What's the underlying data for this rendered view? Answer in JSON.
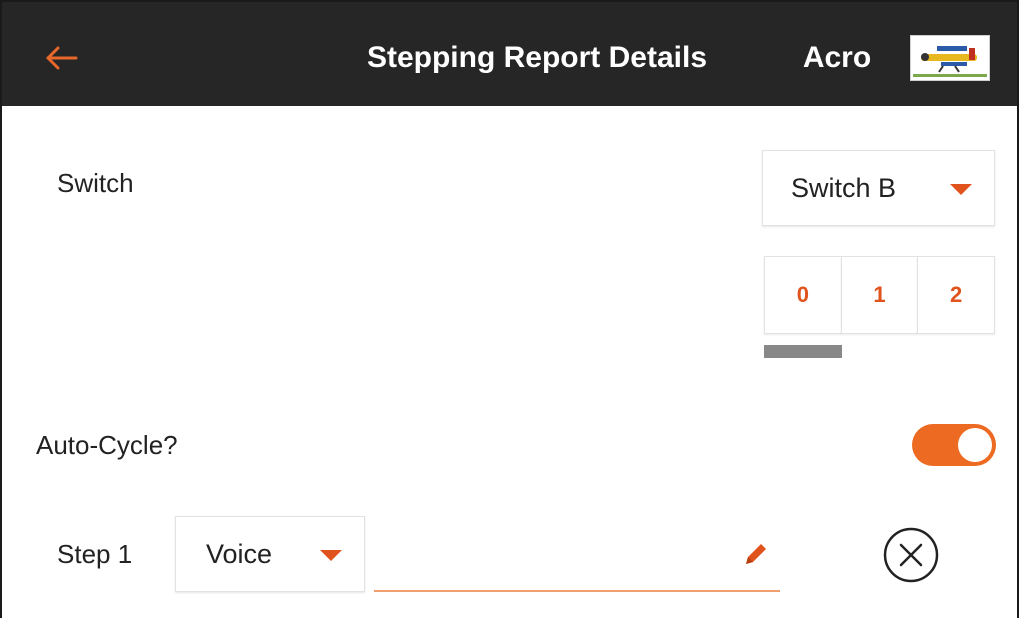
{
  "header": {
    "title": "Stepping Report Details",
    "model_name": "Acro",
    "back_icon": "arrow-left-icon",
    "model_thumbnail": "airplane-thumbnail-icon"
  },
  "switch": {
    "label": "Switch",
    "selected": "Switch B",
    "positions": [
      "0",
      "1",
      "2"
    ],
    "active_position": "0"
  },
  "auto_cycle": {
    "label": "Auto-Cycle?",
    "enabled": true
  },
  "step": {
    "label": "Step 1",
    "type": "Voice",
    "text_value": "",
    "edit_icon": "pencil-icon",
    "remove_icon": "circle-x-icon"
  },
  "colors": {
    "accent": "#e0531c",
    "toggle_on": "#ed6a22",
    "header_bg": "#262626",
    "indicator": "#888888"
  }
}
